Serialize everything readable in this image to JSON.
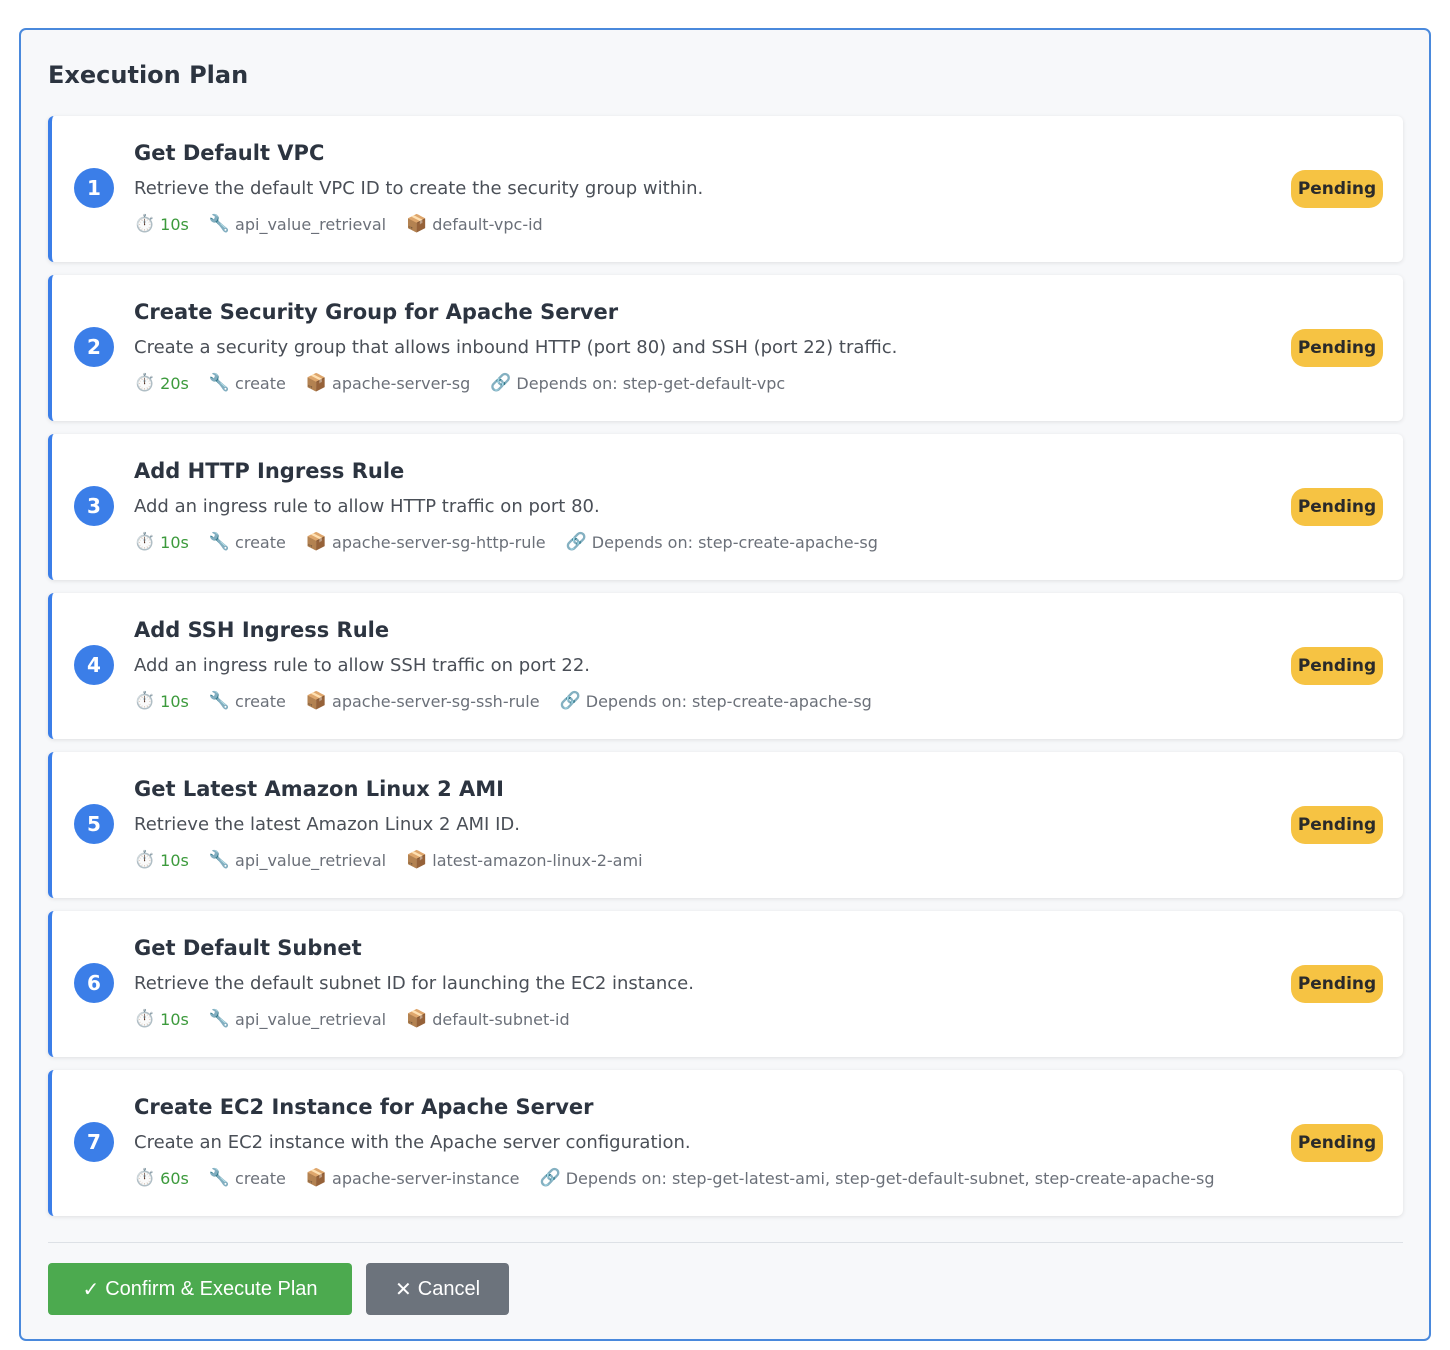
{
  "title": "Execution Plan",
  "steps": [
    {
      "num": "1",
      "title": "Get Default VPC",
      "desc": "Retrieve the default VPC ID to create the security group within.",
      "duration": "10s",
      "action": "api_value_retrieval",
      "resource": "default-vpc-id",
      "depends": "",
      "status": "Pending"
    },
    {
      "num": "2",
      "title": "Create Security Group for Apache Server",
      "desc": "Create a security group that allows inbound HTTP (port 80) and SSH (port 22) traffic.",
      "duration": "20s",
      "action": "create",
      "resource": "apache-server-sg",
      "depends": "Depends on: step-get-default-vpc",
      "status": "Pending"
    },
    {
      "num": "3",
      "title": "Add HTTP Ingress Rule",
      "desc": "Add an ingress rule to allow HTTP traffic on port 80.",
      "duration": "10s",
      "action": "create",
      "resource": "apache-server-sg-http-rule",
      "depends": "Depends on: step-create-apache-sg",
      "status": "Pending"
    },
    {
      "num": "4",
      "title": "Add SSH Ingress Rule",
      "desc": "Add an ingress rule to allow SSH traffic on port 22.",
      "duration": "10s",
      "action": "create",
      "resource": "apache-server-sg-ssh-rule",
      "depends": "Depends on: step-create-apache-sg",
      "status": "Pending"
    },
    {
      "num": "5",
      "title": "Get Latest Amazon Linux 2 AMI",
      "desc": "Retrieve the latest Amazon Linux 2 AMI ID.",
      "duration": "10s",
      "action": "api_value_retrieval",
      "resource": "latest-amazon-linux-2-ami",
      "depends": "",
      "status": "Pending"
    },
    {
      "num": "6",
      "title": "Get Default Subnet",
      "desc": "Retrieve the default subnet ID for launching the EC2 instance.",
      "duration": "10s",
      "action": "api_value_retrieval",
      "resource": "default-subnet-id",
      "depends": "",
      "status": "Pending"
    },
    {
      "num": "7",
      "title": "Create EC2 Instance for Apache Server",
      "desc": "Create an EC2 instance with the Apache server configuration.",
      "duration": "60s",
      "action": "create",
      "resource": "apache-server-instance",
      "depends": "Depends on: step-get-latest-ami, step-get-default-subnet, step-create-apache-sg",
      "status": "Pending"
    }
  ],
  "icons": {
    "duration": "stopwatch-icon",
    "action": "wrench-icon",
    "resource": "package-icon",
    "depends": "link-icon"
  },
  "buttons": {
    "confirm_icon": "✓",
    "confirm": "Confirm & Execute Plan",
    "cancel_icon": "✕",
    "cancel": "Cancel"
  },
  "colors": {
    "accent": "#3b7ee8",
    "pending_badge": "#f6c343",
    "duration_text": "#3c9a3c",
    "confirm_button": "#4caa4f",
    "cancel_button": "#6c737c"
  }
}
